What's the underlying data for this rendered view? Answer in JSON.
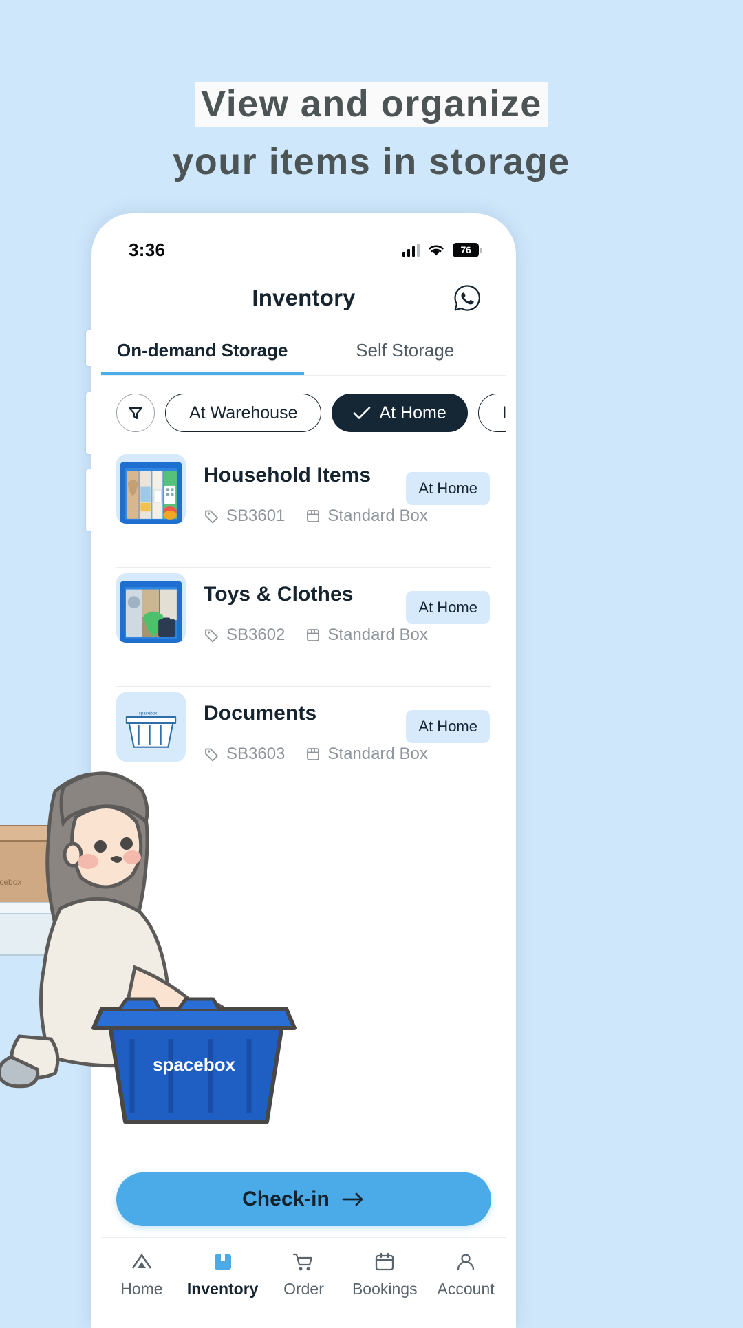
{
  "theme": {
    "background": "#cfe7fb",
    "accent": "#4aabe8",
    "dark": "#152634",
    "badge_bg": "#d6eafc",
    "headline_color": "#4d5456",
    "highlight": "#fafafa"
  },
  "headline": {
    "line1": "View and organize",
    "line2": "your items in storage"
  },
  "status_bar": {
    "time": "3:36",
    "signal_icon": "signal-bars-icon",
    "wifi_icon": "wifi-icon",
    "battery_level": "76"
  },
  "app_bar": {
    "title": "Inventory",
    "action_icon": "whatsapp-icon"
  },
  "tabs": [
    {
      "label": "On-demand Storage",
      "active": true
    },
    {
      "label": "Self Storage",
      "active": false
    }
  ],
  "filters": {
    "filter_icon": "funnel-icon",
    "chips": [
      {
        "label": "At Warehouse",
        "selected": false
      },
      {
        "label": "At Home",
        "selected": true
      },
      {
        "label": "In",
        "selected": false
      }
    ]
  },
  "inventory": {
    "items": [
      {
        "title": "Household Items",
        "badge": "At Home",
        "code": "SB3601",
        "box_type": "Standard Box",
        "tag_icon": "tag-icon",
        "box_icon": "box-icon",
        "thumb_icon": "household-box-photo"
      },
      {
        "title": "Toys & Clothes",
        "badge": "At Home",
        "code": "SB3602",
        "box_type": "Standard Box",
        "tag_icon": "tag-icon",
        "box_icon": "box-icon",
        "thumb_icon": "toys-box-photo"
      },
      {
        "title": "Documents",
        "badge": "At Home",
        "code": "SB3603",
        "box_type": "Standard Box",
        "tag_icon": "tag-icon",
        "box_icon": "box-icon",
        "thumb_icon": "documents-box-illustration"
      }
    ]
  },
  "cta": {
    "label": "Check-in",
    "arrow_icon": "arrow-right-icon"
  },
  "bottom_nav": [
    {
      "label": "Home",
      "icon": "home-icon",
      "active": false
    },
    {
      "label": "Inventory",
      "icon": "inventory-box-icon",
      "active": true
    },
    {
      "label": "Order",
      "icon": "cart-icon",
      "active": false
    },
    {
      "label": "Bookings",
      "icon": "calendar-icon",
      "active": false
    },
    {
      "label": "Account",
      "icon": "person-icon",
      "active": false
    }
  ],
  "illustration": {
    "brand_text": "spacebox",
    "crate_brand_text": "spacebox"
  }
}
